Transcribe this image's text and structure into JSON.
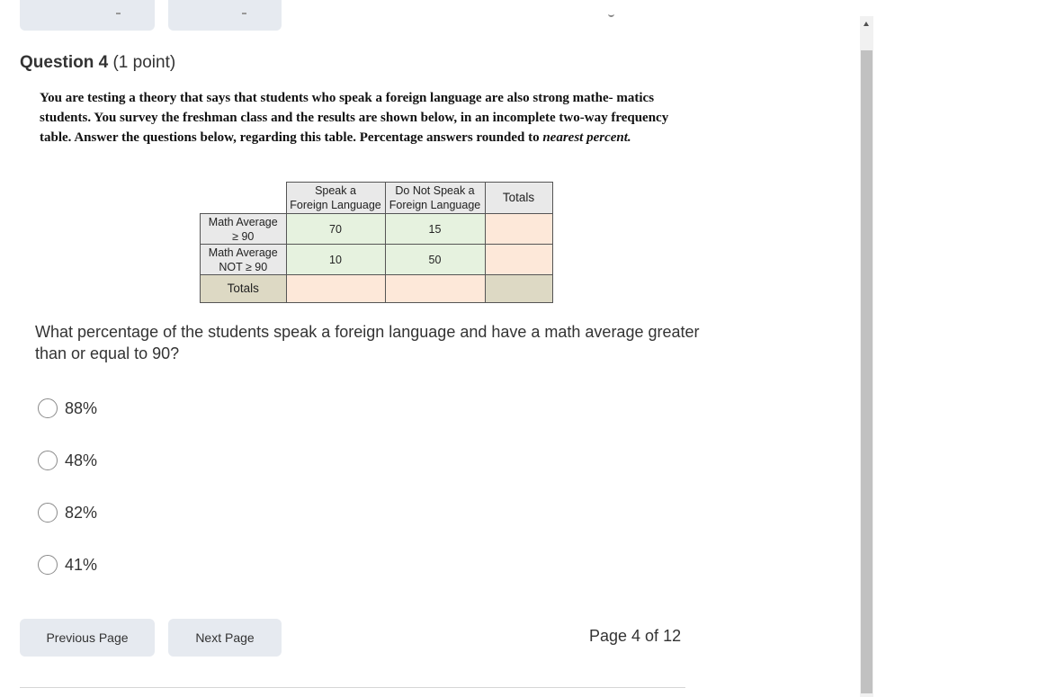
{
  "question": {
    "number_label": "Question 4",
    "points_label": "(1 point)",
    "stem_part1": "You are testing a theory that says that students who speak a foreign language are also strong mathe- matics students. You survey the freshman class and the results are shown below, in an incomplete two-way frequency table. Answer the questions below, regarding this table. Percentage answers rounded to ",
    "stem_emphasis": "nearest percent.",
    "prompt": "What percentage of the students speak a foreign language and have a math average greater than or equal to 90?"
  },
  "table": {
    "headers": {
      "speak_line1": "Speak a",
      "speak_line2": "Foreign Language",
      "not_speak_line1": "Do Not Speak a",
      "not_speak_line2": "Foreign Language",
      "totals": "Totals"
    },
    "rows": [
      {
        "label_line1": "Math Average",
        "label_line2": "≥ 90",
        "speak": "70",
        "not_speak": "15"
      },
      {
        "label_line1": "Math Average",
        "label_line2": "NOT ≥ 90",
        "speak": "10",
        "not_speak": "50"
      }
    ],
    "totals_label": "Totals"
  },
  "choices": [
    {
      "label": "88%"
    },
    {
      "label": "48%"
    },
    {
      "label": "82%"
    },
    {
      "label": "41%"
    }
  ],
  "navigation": {
    "previous_label": "Previous Page",
    "next_label": "Next Page",
    "page_indicator": "Page 4 of 12"
  }
}
